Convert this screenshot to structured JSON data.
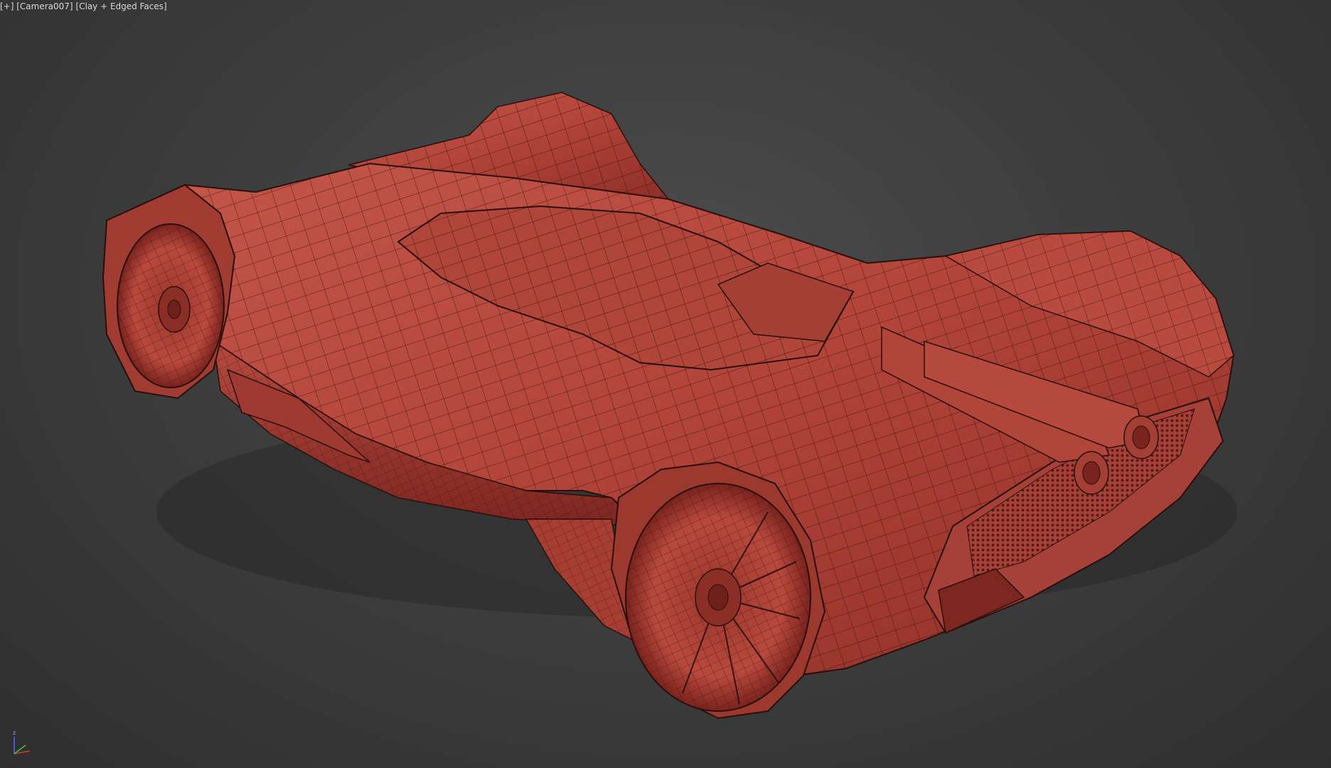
{
  "viewport": {
    "menu_label": "[+]",
    "camera_label": "[Camera007]",
    "shading_label": "[Clay + Edged Faces]",
    "background_color": "#3a3a3a",
    "model_color": "#b4453a",
    "wire_color": "#2a0f0c"
  },
  "gizmo": {
    "z_label": "z",
    "icon": "axis-tripod-icon"
  },
  "model": {
    "type": "concept car, wireframe on shaded",
    "icon": "3d-car-model"
  }
}
